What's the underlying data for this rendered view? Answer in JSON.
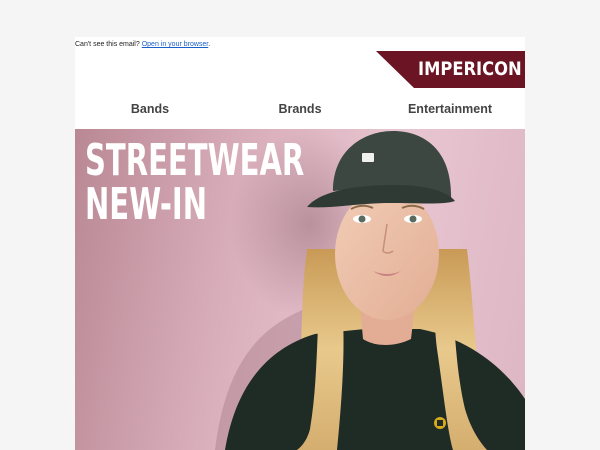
{
  "preheader": {
    "text": "Can't see this email?",
    "link": "Open in your browser",
    "suffix": "."
  },
  "brand": {
    "logo_text": "IMPERICON",
    "color": "#6b1524"
  },
  "nav": {
    "items": [
      {
        "label": "Bands"
      },
      {
        "label": "Brands"
      },
      {
        "label": "Entertainment"
      }
    ]
  },
  "hero": {
    "title_line1": "STREETWEAR",
    "title_line2": "NEW-IN",
    "colors": {
      "background": "#d9aebb",
      "cap": "#3b4740",
      "sweater": "#1f2b25",
      "hair": "#e2c181"
    }
  }
}
